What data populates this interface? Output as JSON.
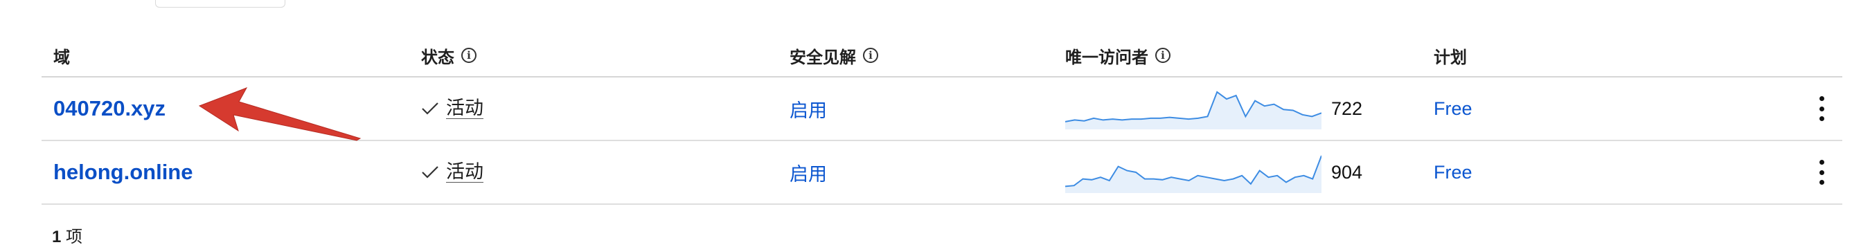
{
  "table": {
    "headers": {
      "domain": "域",
      "status": "状态",
      "security": "安全见解",
      "visitors": "唯一访问者",
      "plan": "计划"
    },
    "rows": [
      {
        "domain": "040720.xyz",
        "status": "活动",
        "security": "启用",
        "visitors": "722",
        "plan": "Free",
        "sparkline": [
          4,
          6,
          5,
          8,
          6,
          7,
          6,
          7,
          7,
          8,
          8,
          9,
          8,
          7,
          8,
          10,
          38,
          30,
          34,
          10,
          28,
          22,
          24,
          18,
          17,
          12,
          10,
          14
        ]
      },
      {
        "domain": "helong.online",
        "status": "活动",
        "security": "启用",
        "visitors": "904",
        "plan": "Free",
        "sparkline": [
          3,
          4,
          12,
          11,
          14,
          10,
          27,
          22,
          20,
          12,
          12,
          11,
          14,
          12,
          10,
          16,
          14,
          12,
          10,
          12,
          16,
          6,
          22,
          14,
          16,
          8,
          14,
          16,
          12,
          40
        ]
      }
    ]
  },
  "footer": {
    "count": "1",
    "unit": "项"
  },
  "colors": {
    "link": "#0b4fc6",
    "sparkline_line": "#3d8ce3",
    "sparkline_fill": "#e6f0fb",
    "annotation_arrow": "#d63a2f"
  },
  "icons": {
    "info": "info-circle-icon",
    "status": "checkmark-icon",
    "menu": "kebab-menu-icon",
    "annotation": "red-arrow-pointer"
  }
}
